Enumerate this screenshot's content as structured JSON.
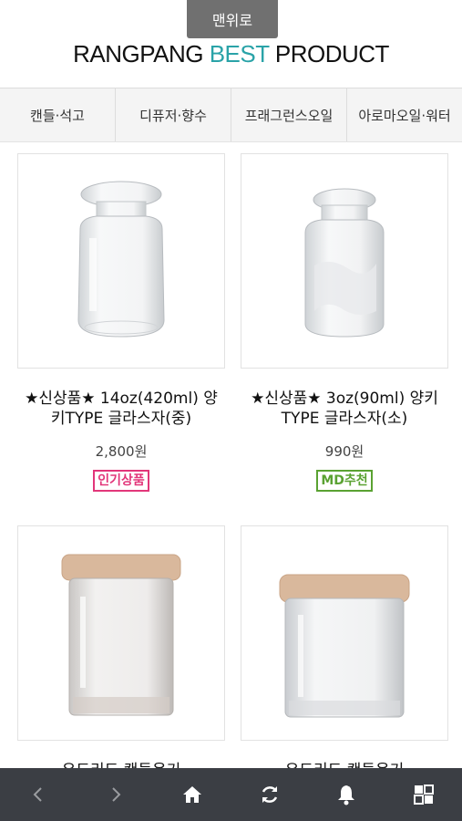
{
  "top_button": {
    "label": "맨위로"
  },
  "title": {
    "prefix": "RANGPANG ",
    "accent": "BEST",
    "suffix": " PRODUCT",
    "accent_color": "#2aa3a8"
  },
  "categories": [
    {
      "label": "캔들·석고"
    },
    {
      "label": "디퓨저·향수"
    },
    {
      "label": "프래그런스오일"
    },
    {
      "label": "아로마오일·워터"
    }
  ],
  "products": [
    {
      "name": "★신상품★ 14oz(420ml) 양키TYPE 글라스자(중)",
      "price": "2,800원",
      "badge": "인기상품",
      "badge_color": "#e2367a",
      "image": "glass-jar-large"
    },
    {
      "name": "★신상품★ 3oz(90ml) 양키TYPE 글라스자(소)",
      "price": "990원",
      "badge": "MD추천",
      "badge_color": "#5aa232",
      "image": "glass-jar-small"
    },
    {
      "name": "우드리드 캔들용기",
      "image": "wood-lid-jar-tall"
    },
    {
      "name": "우드리드 캔들용기",
      "image": "wood-lid-jar-wide"
    }
  ],
  "bottom_nav": [
    {
      "icon": "back-icon"
    },
    {
      "icon": "forward-icon"
    },
    {
      "icon": "home-icon"
    },
    {
      "icon": "refresh-icon"
    },
    {
      "icon": "bell-icon"
    },
    {
      "icon": "menu-grid-icon"
    }
  ]
}
